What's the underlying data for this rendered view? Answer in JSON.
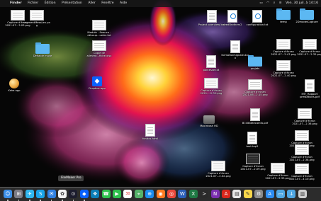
{
  "menubar": {
    "apple": "",
    "app_name": "Finder",
    "menus": [
      "Fichier",
      "Édition",
      "Présentation",
      "Aller",
      "Fenêtre",
      "Aide"
    ],
    "clock": "Ven. 30 juil. à 14:16",
    "battery": "▭",
    "wifi": "◠",
    "search": "⌕",
    "control_center": "≡"
  },
  "desktop": {
    "items": [
      {
        "label": "Capture d'écran 2021-07...3.03.png",
        "kind": "shot"
      },
      {
        "label": "segmentMessLen.png",
        "kind": "shot"
      },
      {
        "label": "Module - finance - découp...ueles.txt",
        "kind": "shot"
      },
      {
        "label": "Project overview bak",
        "kind": "doc"
      },
      {
        "label": "seedBrothers2",
        "kind": "doc-blue"
      },
      {
        "label": "configuration.txt",
        "kind": "doc-blue"
      },
      {
        "label": "temp",
        "kind": "folder"
      },
      {
        "label": "2DmodelCapture",
        "kind": "folder"
      },
      {
        "label": "Copie de aliment...fiche.xlsx",
        "kind": "shot"
      },
      {
        "label": "formationSignale.docx",
        "kind": "doc"
      },
      {
        "label": "Capture d'écran 2021-07...2.47.png",
        "kind": "shot"
      },
      {
        "label": "Capture d'écran 2021-07...2.32.png",
        "kind": "shot"
      },
      {
        "label": "Défiable muse",
        "kind": "folder"
      },
      {
        "label": "politesse.txt",
        "kind": "doc"
      },
      {
        "label": "projets",
        "kind": "folder"
      },
      {
        "label": "Capture d'écran 2021-07...2.40.png",
        "kind": "shot"
      },
      {
        "label": "Dropbox.app",
        "kind": "dropbox"
      },
      {
        "label": "Capture d'écran 2021-...2.32.png",
        "kind": "shot"
      },
      {
        "label": "Capture d'écran 2021-06...2.45.png",
        "kind": "shot"
      },
      {
        "label": "Kaka.app",
        "kind": "gift"
      },
      {
        "label": "IMT_Rapport prestations.pdf",
        "kind": "doc"
      },
      {
        "label": "Macintosh HD",
        "kind": "disk"
      },
      {
        "label": "Bl ditatitecaInfo.pdf",
        "kind": "doc"
      },
      {
        "label": "Capture d'écran 2021-07...2.36.png",
        "kind": "shot"
      },
      {
        "label": "fondos.html",
        "kind": "doc"
      },
      {
        "label": "text-top2",
        "kind": "doc"
      },
      {
        "label": "Capture d'écran 2021-07...2.09.png",
        "kind": "shot"
      },
      {
        "label": "Capture d'écran 2021-07...2.02.png",
        "kind": "shot"
      },
      {
        "label": "Capture d'écran 2021-07...2.09.png",
        "kind": "shot-dark"
      },
      {
        "label": "Capture d'écran 2021-07...2.33.png",
        "kind": "shot"
      },
      {
        "label": "Capture d'écran 2021-07...2.38.png",
        "kind": "shot"
      },
      {
        "label": "Capture d'écran 2021-07...4.10.png",
        "kind": "shot"
      }
    ]
  },
  "tooltip": "FileMaker Pro",
  "dock": {
    "icons": [
      {
        "name": "finder",
        "color": "#3b8fe8",
        "glyph": "☺"
      },
      {
        "name": "launchpad",
        "color": "#7d7d86",
        "glyph": "⊞"
      },
      {
        "name": "mission-control",
        "color": "#30b7ef",
        "glyph": "✈"
      },
      {
        "name": "skype",
        "color": "#1aa3e8",
        "glyph": "S"
      },
      {
        "name": "mail",
        "color": "#2f7fe0",
        "glyph": "✉"
      },
      {
        "name": "photos",
        "color": "#f4f4f4",
        "glyph": "✿"
      },
      {
        "name": "filemaker",
        "color": "#1c1c2e",
        "glyph": "⊙"
      },
      {
        "name": "dropbox",
        "color": "#0a61fe",
        "glyph": "◆"
      },
      {
        "name": "tools",
        "color": "#0c7fb8",
        "glyph": "❖"
      },
      {
        "name": "messages",
        "color": "#2ec24d",
        "glyph": "☎"
      },
      {
        "name": "facetime",
        "color": "#2ec24d",
        "glyph": "▶"
      },
      {
        "name": "calendar",
        "color": "#ffffff",
        "glyph": "30"
      },
      {
        "name": "maps",
        "color": "#55b36a",
        "glyph": "⌖"
      },
      {
        "name": "safari",
        "color": "#1a8df0",
        "glyph": "⊕"
      },
      {
        "name": "firefox",
        "color": "#ff7b22",
        "glyph": "◉"
      },
      {
        "name": "chrome",
        "color": "#e9483b",
        "glyph": "◎"
      },
      {
        "name": "word",
        "color": "#2b5fb8",
        "glyph": "W"
      },
      {
        "name": "excel",
        "color": "#1f7a44",
        "glyph": "X"
      },
      {
        "name": "terminal",
        "color": "#2a2a2a",
        "glyph": ">"
      },
      {
        "name": "onenote",
        "color": "#7b2fb0",
        "glyph": "N"
      },
      {
        "name": "acrobat",
        "color": "#d8261b",
        "glyph": "A"
      },
      {
        "name": "preview",
        "color": "#e9e9e9",
        "glyph": "▤"
      },
      {
        "name": "notes",
        "color": "#f8d64a",
        "glyph": "✎"
      },
      {
        "name": "preferences",
        "color": "#8b8b8b",
        "glyph": "⚙"
      },
      {
        "name": "appstore",
        "color": "#2d8cf0",
        "glyph": "A"
      },
      {
        "name": "folder-docs",
        "color": "#4fa7e3",
        "glyph": "▭"
      },
      {
        "name": "folder-downloads",
        "color": "#4fa7e3",
        "glyph": "↓"
      },
      {
        "name": "trash",
        "color": "#cfcfcf",
        "glyph": "▥"
      }
    ]
  }
}
